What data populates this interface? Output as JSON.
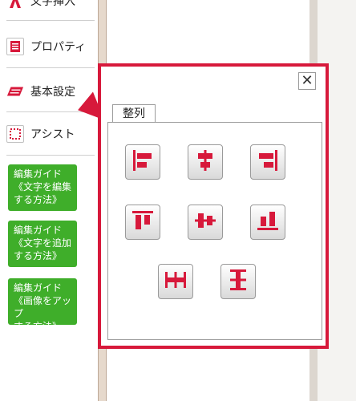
{
  "sidebar": {
    "items": [
      {
        "label": "文字挿入",
        "icon": "text-insert-icon"
      },
      {
        "label": "プロパティ",
        "icon": "properties-icon"
      },
      {
        "label": "基本設定",
        "icon": "basic-settings-icon"
      },
      {
        "label": "アシスト",
        "icon": "assist-icon"
      }
    ],
    "guides": [
      {
        "label": "編集ガイド\n《文字を編集\nする方法》"
      },
      {
        "label": "編集ガイド\n《文字を追加\nする方法》"
      },
      {
        "label": "編集ガイド\n《画像をアップ\nする方法》"
      }
    ]
  },
  "panel": {
    "close_label": "✕",
    "tab_label": "整列",
    "align_buttons": [
      {
        "name": "align-left"
      },
      {
        "name": "align-center-horizontal"
      },
      {
        "name": "align-right"
      },
      {
        "name": "align-top"
      },
      {
        "name": "align-middle-vertical"
      },
      {
        "name": "align-bottom"
      },
      {
        "name": "distribute-horizontal"
      },
      {
        "name": "distribute-vertical"
      }
    ]
  },
  "colors": {
    "accent": "#d7193b",
    "guide_green": "#3fae2a",
    "icon_red": "#d7193b"
  }
}
